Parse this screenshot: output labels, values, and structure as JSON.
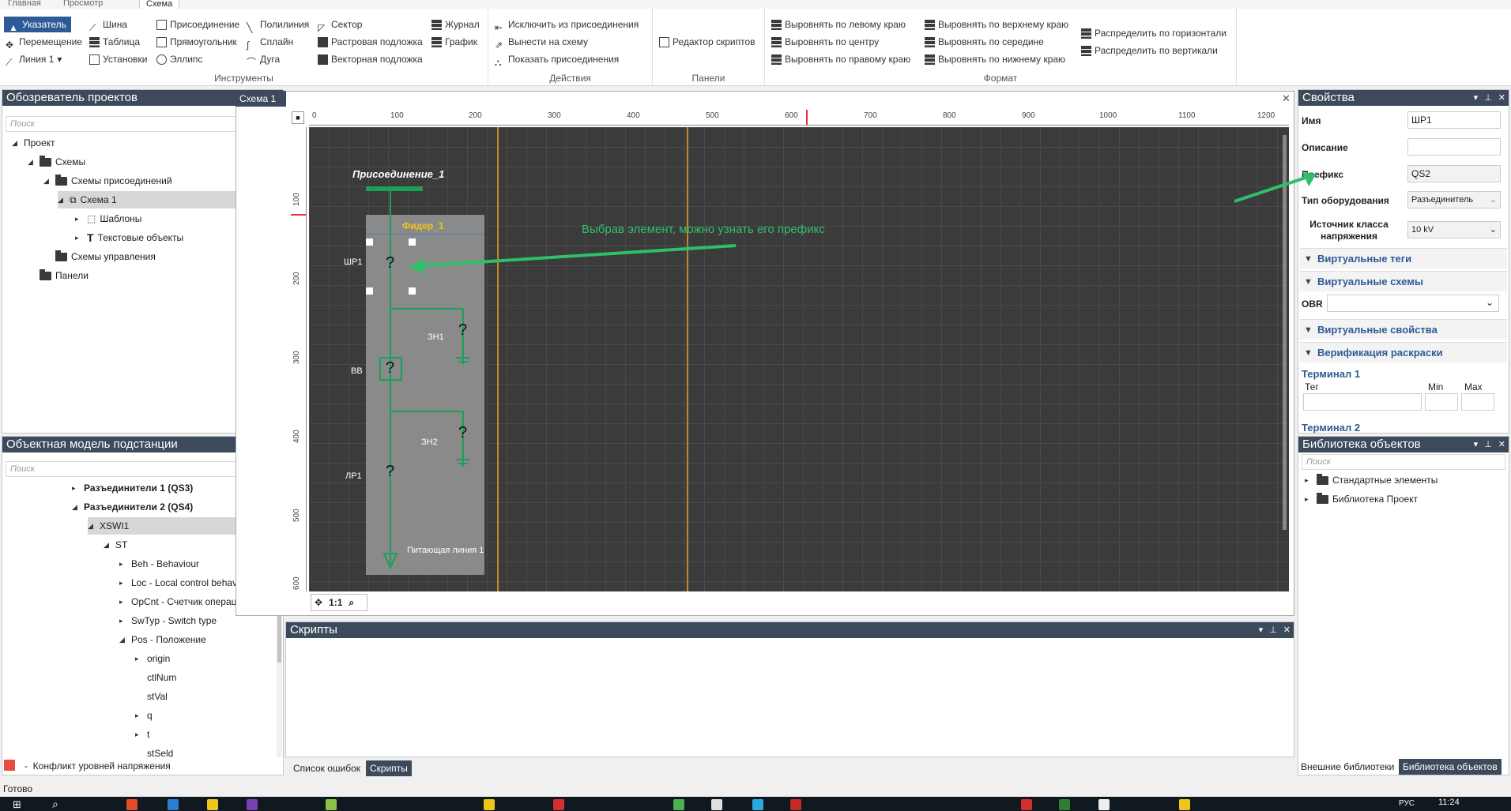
{
  "menu": {
    "tabs": [
      "Главная",
      "Просмотр",
      "Схема"
    ],
    "active": "Схема"
  },
  "ribbon": {
    "tools": {
      "title": "Инструменты",
      "pointer": "Указатель",
      "move": "Перемещение",
      "line": "Линия 1",
      "bus": "Шина",
      "table": "Таблица",
      "settings": "Установки",
      "connection": "Присоединение",
      "rectangle": "Прямоугольник",
      "ellipse": "Эллипс",
      "polyline": "Полилиния",
      "spline": "Сплайн",
      "arc": "Дуга",
      "sector": "Сектор",
      "raster": "Растровая подложка",
      "vector": "Векторная подложка",
      "journal": "Журнал",
      "graph": "График"
    },
    "actions": {
      "title": "Действия",
      "exclude": "Исключить из присоединения",
      "move_out": "Вынести на схему",
      "show": "Показать присоединения"
    },
    "panels": {
      "title": "Панели",
      "script_editor": "Редактор скриптов"
    },
    "format": {
      "title": "Формат",
      "left": "Выровнять по левому краю",
      "center": "Выровнять по центру",
      "right": "Выровнять по правому краю",
      "top": "Выровнять по верхнему краю",
      "middle": "Выровнять по середине",
      "bottom": "Выровнять по нижнему краю",
      "dist_h": "Распределить по горизонтали",
      "dist_v": "Распределить по вертикали"
    }
  },
  "explorer": {
    "title": "Обозреватель проектов",
    "search": "Поиск",
    "items": [
      "Проект",
      "Схемы",
      "Схемы присоединений",
      "Схема 1",
      "Шаблоны",
      "Текстовые объекты",
      "Схемы управления",
      "Панели"
    ]
  },
  "objmodel": {
    "title": "Объектная модель подстанции",
    "search": "Поиск",
    "items": [
      "Разъединители 1 (QS3)",
      "Разъединители 2 (QS4)",
      "XSWI1",
      "ST",
      "Beh - Behaviour",
      "Loc - Local control behaviour",
      "OpCnt - Счетчик операций",
      "SwTyp - Switch type",
      "Pos - Положение",
      "origin",
      "ctlNum",
      "stVal",
      "q",
      "t",
      "stSeld"
    ],
    "legend": "Конфликт уровней напряжения"
  },
  "document": {
    "tab": "Схема 1"
  },
  "ruler": {
    "h": [
      "0",
      "100",
      "200",
      "300",
      "400",
      "500",
      "600",
      "700",
      "800",
      "900",
      "1000",
      "1100",
      "1200"
    ],
    "v": [
      "100",
      "200",
      "300",
      "400",
      "500",
      "600"
    ]
  },
  "scheme": {
    "connection_title": "Присоединение_1",
    "feeder": "Фидер_1",
    "annotation": "Выбрав элемент, можно узнать его префикс",
    "labels": {
      "shr1": "ШР1",
      "zn1": "ЗН1",
      "vv": "ВВ",
      "zn2": "ЗН2",
      "lr1": "ЛР1",
      "line": "Питающая линия 1"
    },
    "unknown": "?",
    "zoom": "1:1"
  },
  "scripts": {
    "title": "Скрипты",
    "tabs": [
      "Список ошибок",
      "Скрипты"
    ]
  },
  "properties": {
    "title": "Свойства",
    "name_label": "Имя",
    "name_value": "ШР1",
    "desc_label": "Описание",
    "prefix_label": "Префикс",
    "prefix_value": "QS2",
    "type_label": "Тип оборудования",
    "type_value": "Разъединитель",
    "voltage_label": "Источник класса напряжения",
    "voltage_value": "10 kV",
    "sections": [
      "Виртуальные теги",
      "Виртуальные схемы",
      "Виртуальные свойства",
      "Верификация раскраски"
    ],
    "obr": "OBR",
    "terminal1": "Терминал 1",
    "tag": "Тег",
    "min": "Min",
    "max": "Max",
    "terminal2": "Терминал 2"
  },
  "library": {
    "title": "Библиотека объектов",
    "search": "Поиск",
    "items": [
      "Стандартные элементы",
      "Библиотека Проект"
    ],
    "tabs": [
      "Внешние библиотеки",
      "Библиотека объектов"
    ]
  },
  "status": {
    "text": "Готово",
    "lang": "РУС",
    "time": "11:24"
  },
  "colors": {
    "panel_title": "#3c4a5c",
    "accent": "#2e5a96",
    "scheme_green": "#1aa05a",
    "feeder_yellow": "#f0c419",
    "annotation_green": "#2dbf6a"
  }
}
